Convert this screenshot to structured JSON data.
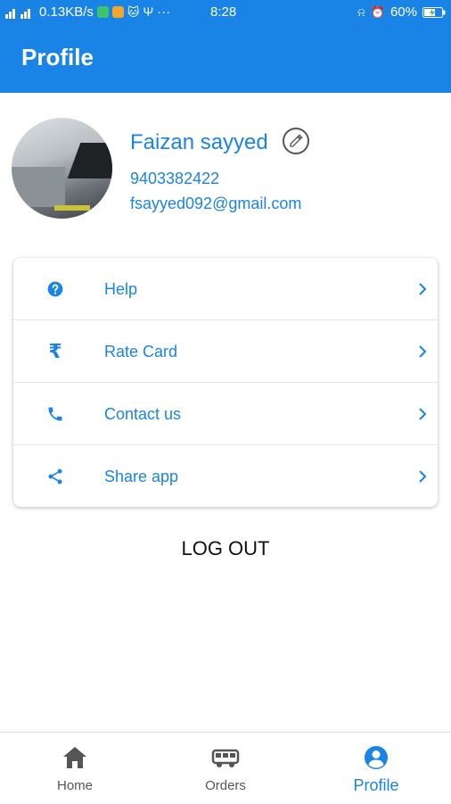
{
  "status_bar": {
    "speed": "0.13KB/s",
    "time": "8:28",
    "battery": "60%"
  },
  "header": {
    "title": "Profile"
  },
  "profile": {
    "name": "Faizan sayyed",
    "phone": "9403382422",
    "email": "fsayyed092@gmail.com"
  },
  "menu": {
    "items": [
      {
        "label": "Help",
        "icon": "help-circle-icon"
      },
      {
        "label": "Rate Card",
        "icon": "rupee-icon"
      },
      {
        "label": "Contact us",
        "icon": "phone-icon"
      },
      {
        "label": "Share app",
        "icon": "share-icon"
      }
    ]
  },
  "logout_label": "LOG OUT",
  "bottom_nav": {
    "items": [
      {
        "label": "Home",
        "icon": "home-icon",
        "active": false
      },
      {
        "label": "Orders",
        "icon": "truck-icon",
        "active": false
      },
      {
        "label": "Profile",
        "icon": "account-icon",
        "active": true
      }
    ]
  },
  "colors": {
    "primary": "#1a84e6",
    "text_dark": "#111111",
    "nav_inactive": "#555555"
  }
}
